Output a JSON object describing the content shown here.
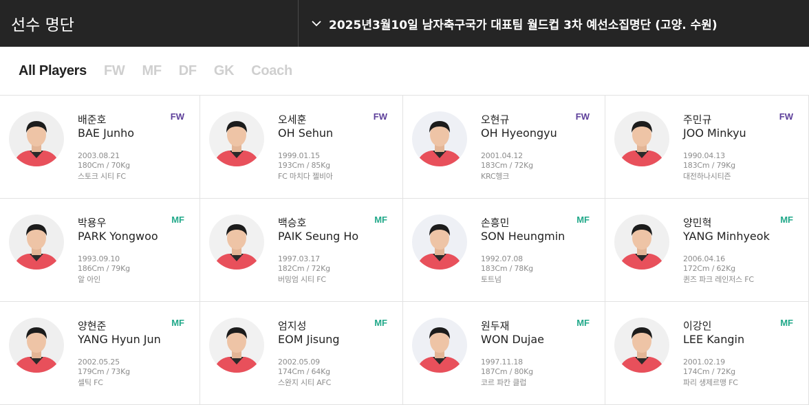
{
  "header": {
    "title": "선수 명단",
    "selected_squad": "2025년3월10일 남자축구국가 대표팀 월드컵 3차 예선소집명단 (고양. 수원)"
  },
  "tabs": [
    {
      "label": "All Players",
      "active": true
    },
    {
      "label": "FW",
      "active": false
    },
    {
      "label": "MF",
      "active": false
    },
    {
      "label": "DF",
      "active": false
    },
    {
      "label": "GK",
      "active": false
    },
    {
      "label": "Coach",
      "active": false
    }
  ],
  "colors": {
    "header_bg": "#252525",
    "fw": "#5d3f9a",
    "mf": "#22a98a",
    "jersey": "#e8505b"
  },
  "players": [
    {
      "kname": "배준호",
      "ename": "BAE Junho",
      "position": "FW",
      "birth": "2003.08.21",
      "body": "180Cm / 70Kg",
      "club": "스토크 시티 FC"
    },
    {
      "kname": "오세훈",
      "ename": "OH Sehun",
      "position": "FW",
      "birth": "1999.01.15",
      "body": "193Cm / 85Kg",
      "club": "FC 마치다 젤비아"
    },
    {
      "kname": "오현규",
      "ename": "OH Hyeongyu",
      "position": "FW",
      "birth": "2001.04.12",
      "body": "183Cm / 72Kg",
      "club": "KRC헹크"
    },
    {
      "kname": "주민규",
      "ename": "JOO Minkyu",
      "position": "FW",
      "birth": "1990.04.13",
      "body": "183Cm / 79Kg",
      "club": "대전하나시티즌"
    },
    {
      "kname": "박용우",
      "ename": "PARK Yongwoo",
      "position": "MF",
      "birth": "1993.09.10",
      "body": "186Cm / 79Kg",
      "club": "알 아인"
    },
    {
      "kname": "백승호",
      "ename": "PAIK Seung Ho",
      "position": "MF",
      "birth": "1997.03.17",
      "body": "182Cm / 72Kg",
      "club": "버밍엄 시티 FC"
    },
    {
      "kname": "손흥민",
      "ename": "SON Heungmin",
      "position": "MF",
      "birth": "1992.07.08",
      "body": "183Cm / 78Kg",
      "club": "토트넘"
    },
    {
      "kname": "양민혁",
      "ename": "YANG Minhyeok",
      "position": "MF",
      "birth": "2006.04.16",
      "body": "172Cm / 62Kg",
      "club": "퀸즈 파크 레인저스 FC"
    },
    {
      "kname": "양현준",
      "ename": "YANG Hyun Jun",
      "position": "MF",
      "birth": "2002.05.25",
      "body": "179Cm / 73Kg",
      "club": "셀틱 FC"
    },
    {
      "kname": "엄지성",
      "ename": "EOM Jisung",
      "position": "MF",
      "birth": "2002.05.09",
      "body": "174Cm / 64Kg",
      "club": "스완지 시티 AFC"
    },
    {
      "kname": "원두재",
      "ename": "WON Dujae",
      "position": "MF",
      "birth": "1997.11.18",
      "body": "187Cm / 80Kg",
      "club": "코르 파칸 클럽"
    },
    {
      "kname": "이강인",
      "ename": "LEE Kangin",
      "position": "MF",
      "birth": "2001.02.19",
      "body": "174Cm / 72Kg",
      "club": "파리 생제르맹 FC"
    }
  ]
}
